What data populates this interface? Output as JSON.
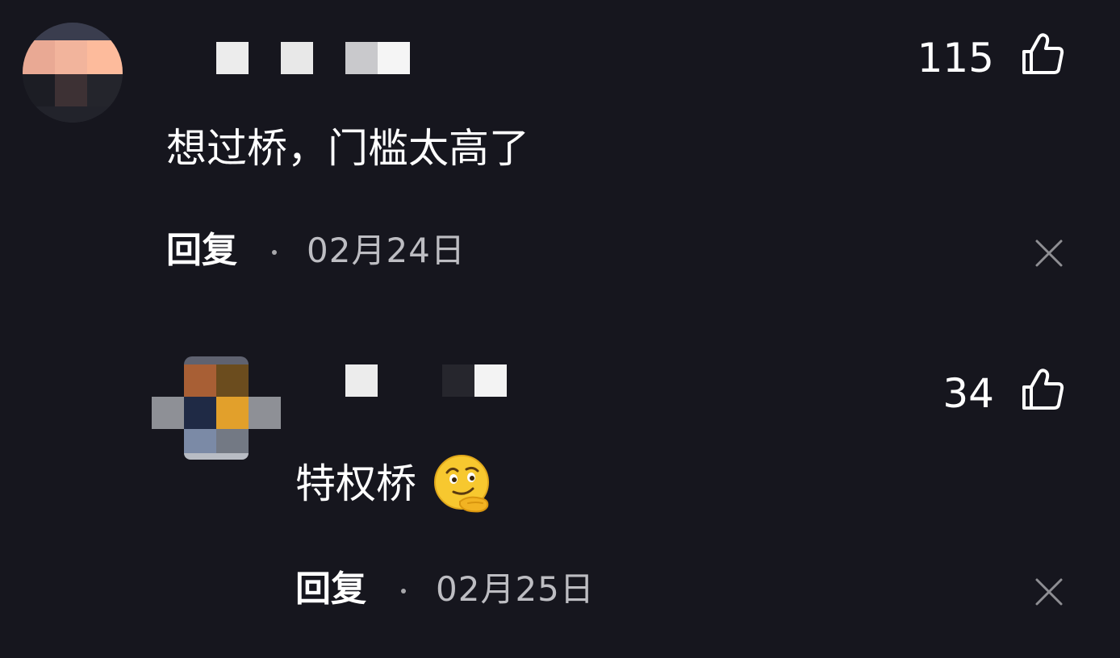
{
  "comments": [
    {
      "likes": "115",
      "text": "想过桥，门槛太高了",
      "reply_label": "回复",
      "date": "02月24日"
    },
    {
      "likes": "34",
      "text": "特权桥",
      "emoji": "smirking-thinking-emoji",
      "reply_label": "回复",
      "date": "02月25日"
    }
  ],
  "icons": {
    "like": "thumbs-up-icon",
    "dismiss": "close-icon"
  },
  "colors": {
    "background": "#16161e",
    "text": "#ffffff",
    "secondary_text": "#bdbdc2",
    "icon_gray": "#8e8e93"
  }
}
